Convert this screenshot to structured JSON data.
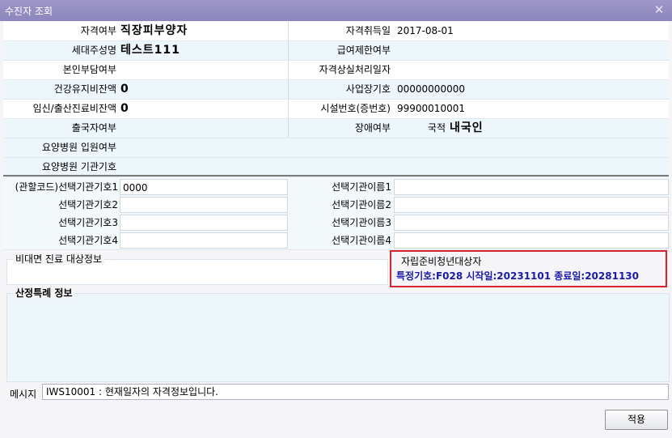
{
  "window": {
    "title": "수진자 조회",
    "close_glyph": "✕"
  },
  "info": {
    "qualification_type_label": "자격여부",
    "qualification_type_value": "직장피부양자",
    "acquisition_date_label": "자격취득일",
    "acquisition_date_value": "2017-08-01",
    "householder_label": "세대주성명",
    "householder_value": "테스트111",
    "benefit_limit_label": "급여제한여부",
    "benefit_limit_value": "",
    "copay_label": "본인부담여부",
    "copay_value": "",
    "loss_processing_label": "자격상실처리일자",
    "loss_processing_value": "",
    "health_balance_label": "건강유지비잔액",
    "health_balance_value": "0",
    "workplace_code_label": "사업장기호",
    "workplace_code_value": "00000000000",
    "pregnancy_balance_label": "임신/출산진료비잔액",
    "pregnancy_balance_value": "0",
    "facility_number_label": "시설번호(증번호)",
    "facility_number_value": "99900010001",
    "departure_label": "출국자여부",
    "departure_value": "",
    "disability_label": "장애여부",
    "nationality_label": "국적",
    "nationality_value": "내국인",
    "nursing_admission_label": "요양병원 입원여부",
    "nursing_admission_value": "",
    "nursing_code_label": "요양병원 기관기호",
    "nursing_code_value": ""
  },
  "selection": {
    "code1_label": "(관할코드)선택기관기호1",
    "code1_value": "0000",
    "name1_label": "선택기관이름1",
    "name1_value": "",
    "code2_label": "선택기관기호2",
    "code2_value": "",
    "name2_label": "선택기관이름2",
    "name2_value": "",
    "code3_label": "선택기관기호3",
    "code3_value": "",
    "name3_label": "선택기관이름3",
    "name3_value": "",
    "code4_label": "선택기관기호4",
    "code4_value": "",
    "name4_label": "선택기관이름4",
    "name4_value": ""
  },
  "telemedicine": {
    "title": "비대면 진료 대상정보"
  },
  "youth": {
    "title": "자립준비청년대상자",
    "detail": "특정기호:F028 시작일:20231101 종료일:20281130"
  },
  "special": {
    "title": "산정특례 정보"
  },
  "message": {
    "label": "메시지",
    "value": "IWS10001 : 현재일자의 자격정보입니다."
  },
  "apply_button": "적용",
  "colors": {
    "titlebar": "#9e97c8",
    "highlight_border": "#d6242f",
    "detail_text": "#1a1aaa"
  }
}
